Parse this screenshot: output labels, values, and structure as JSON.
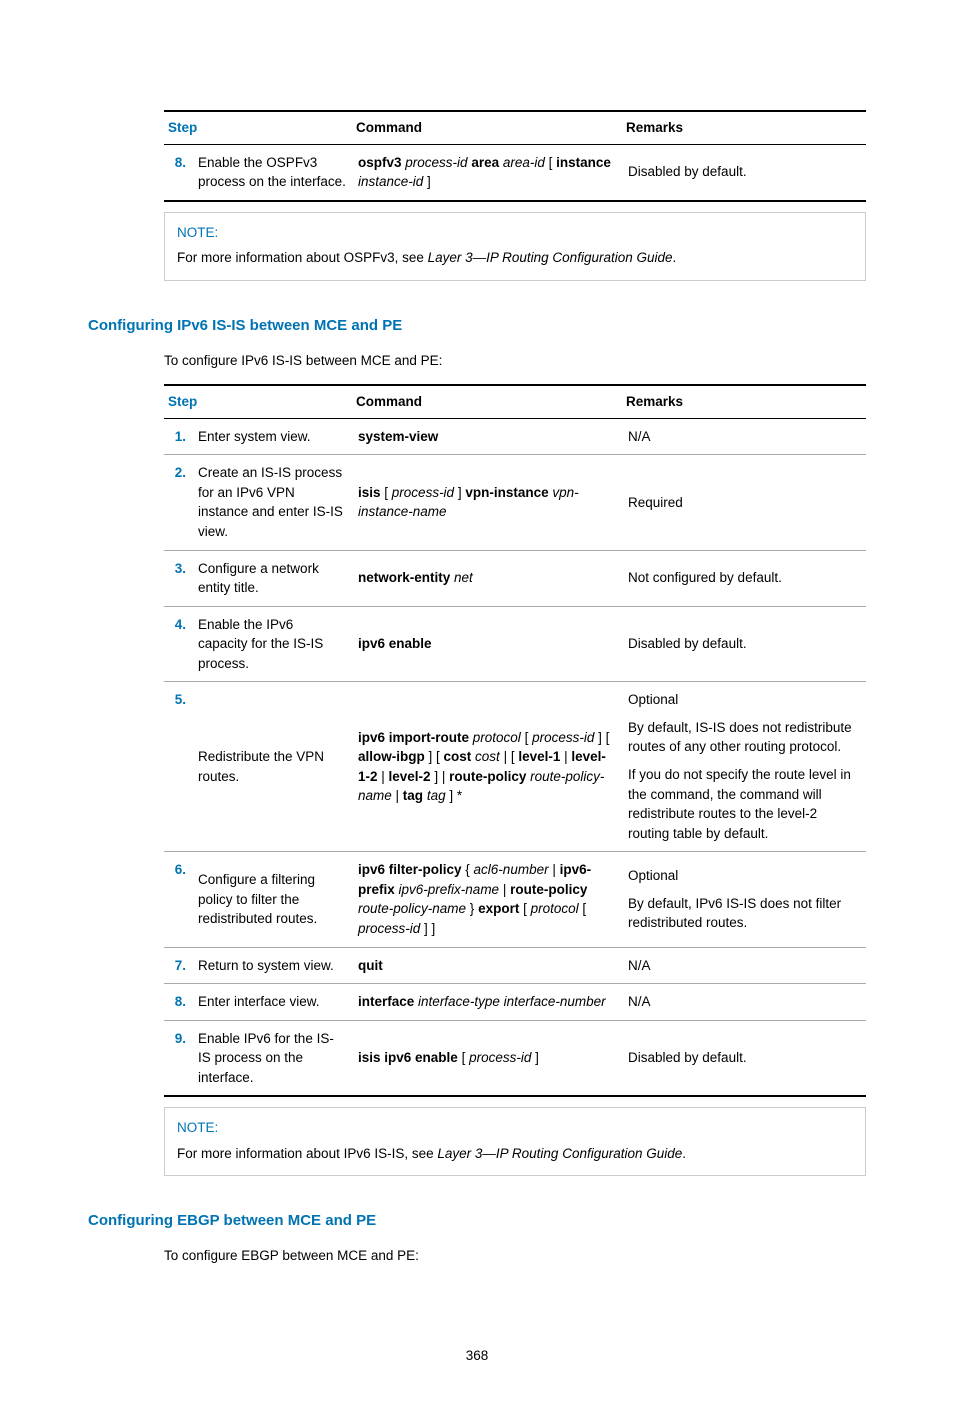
{
  "table1": {
    "headers": {
      "step": "Step",
      "command": "Command",
      "remarks": "Remarks"
    },
    "rows": [
      {
        "num": "8.",
        "step": "Enable the OSPFv3 process on the interface.",
        "command": "<b>ospfv3</b> <i>process-id</i> <b>area</b> <i>area-id</i> [ <b>instance</b> <i>instance-id</i> ]",
        "remarks": "Disabled by default."
      }
    ]
  },
  "note1": {
    "label": "NOTE:",
    "text": "For more information about OSPFv3, see <i>Layer 3—IP Routing Configuration Guide</i>."
  },
  "section2": {
    "heading": "Configuring IPv6 IS-IS between MCE and PE",
    "intro": "To configure IPv6 IS-IS between MCE and PE:"
  },
  "table2": {
    "headers": {
      "step": "Step",
      "command": "Command",
      "remarks": "Remarks"
    },
    "rows": [
      {
        "num": "1.",
        "step": "Enter system view.",
        "command": "<b>system-view</b>",
        "remarks": "N/A"
      },
      {
        "num": "2.",
        "step": "Create an IS-IS process for an IPv6 VPN instance and enter IS-IS view.",
        "command": "<b>isis</b> [ <i>process-id</i> ] <b>vpn-instance</b> <i>vpn-instance-name</i>",
        "remarks": "Required"
      },
      {
        "num": "3.",
        "step": "Configure a network entity title.",
        "command": "<b>network-entity</b> <i>net</i>",
        "remarks": "Not configured by default."
      },
      {
        "num": "4.",
        "step": "Enable the IPv6 capacity for the IS-IS process.",
        "command": "<b>ipv6 enable</b>",
        "remarks": "Disabled by default."
      },
      {
        "num": "5.",
        "step": "Redistribute the VPN routes.",
        "command": "<b>ipv6 import-route</b> <i>protocol</i> [ <i>process-id</i> ] [ <b>allow-ibgp</b> ] [ <b>cost</b> <i>cost</i> | [ <b>level-1</b> | <b>level-1-2</b> | <b>level-2</b> ] | <b>route-policy</b> <i>route-policy-name</i> | <b>tag</b> <i>tag</i> ] *",
        "remarks": "<p>Optional</p><p>By default, IS-IS does not redistribute routes of any other routing protocol.</p><p>If you do not specify the route level in the command, the command will redistribute routes to the level-2 routing table by default.</p>"
      },
      {
        "num": "6.",
        "step": "Configure a filtering policy to filter the redistributed routes.",
        "command": "<b>ipv6 filter-policy</b> { <i>acl6-number</i> | <b>ipv6-prefix</b> <i>ipv6-prefix-name</i> | <b>route-policy</b> <i>route-policy-name</i> } <b>export</b> [ <i>protocol</i> [ <i>process-id</i> ] ]",
        "remarks": "<p>Optional</p><p>By default, IPv6 IS-IS does not filter redistributed routes.</p>"
      },
      {
        "num": "7.",
        "step": "Return to system view.",
        "command": "<b>quit</b>",
        "remarks": "N/A"
      },
      {
        "num": "8.",
        "step": "Enter interface view.",
        "command": "<b>interface</b> <i>interface-type interface-number</i>",
        "remarks": "N/A"
      },
      {
        "num": "9.",
        "step": "Enable IPv6 for the IS-IS process on the interface.",
        "command": "<b>isis ipv6 enable</b> [ <i>process-id</i> ]",
        "remarks": "Disabled by default."
      }
    ]
  },
  "note2": {
    "label": "NOTE:",
    "text": "For more information about IPv6 IS-IS, see <i>Layer 3—IP Routing Configuration Guide</i>."
  },
  "section3": {
    "heading": "Configuring EBGP between MCE and PE",
    "intro": "To configure EBGP between MCE and PE:"
  },
  "pageNumber": "368"
}
